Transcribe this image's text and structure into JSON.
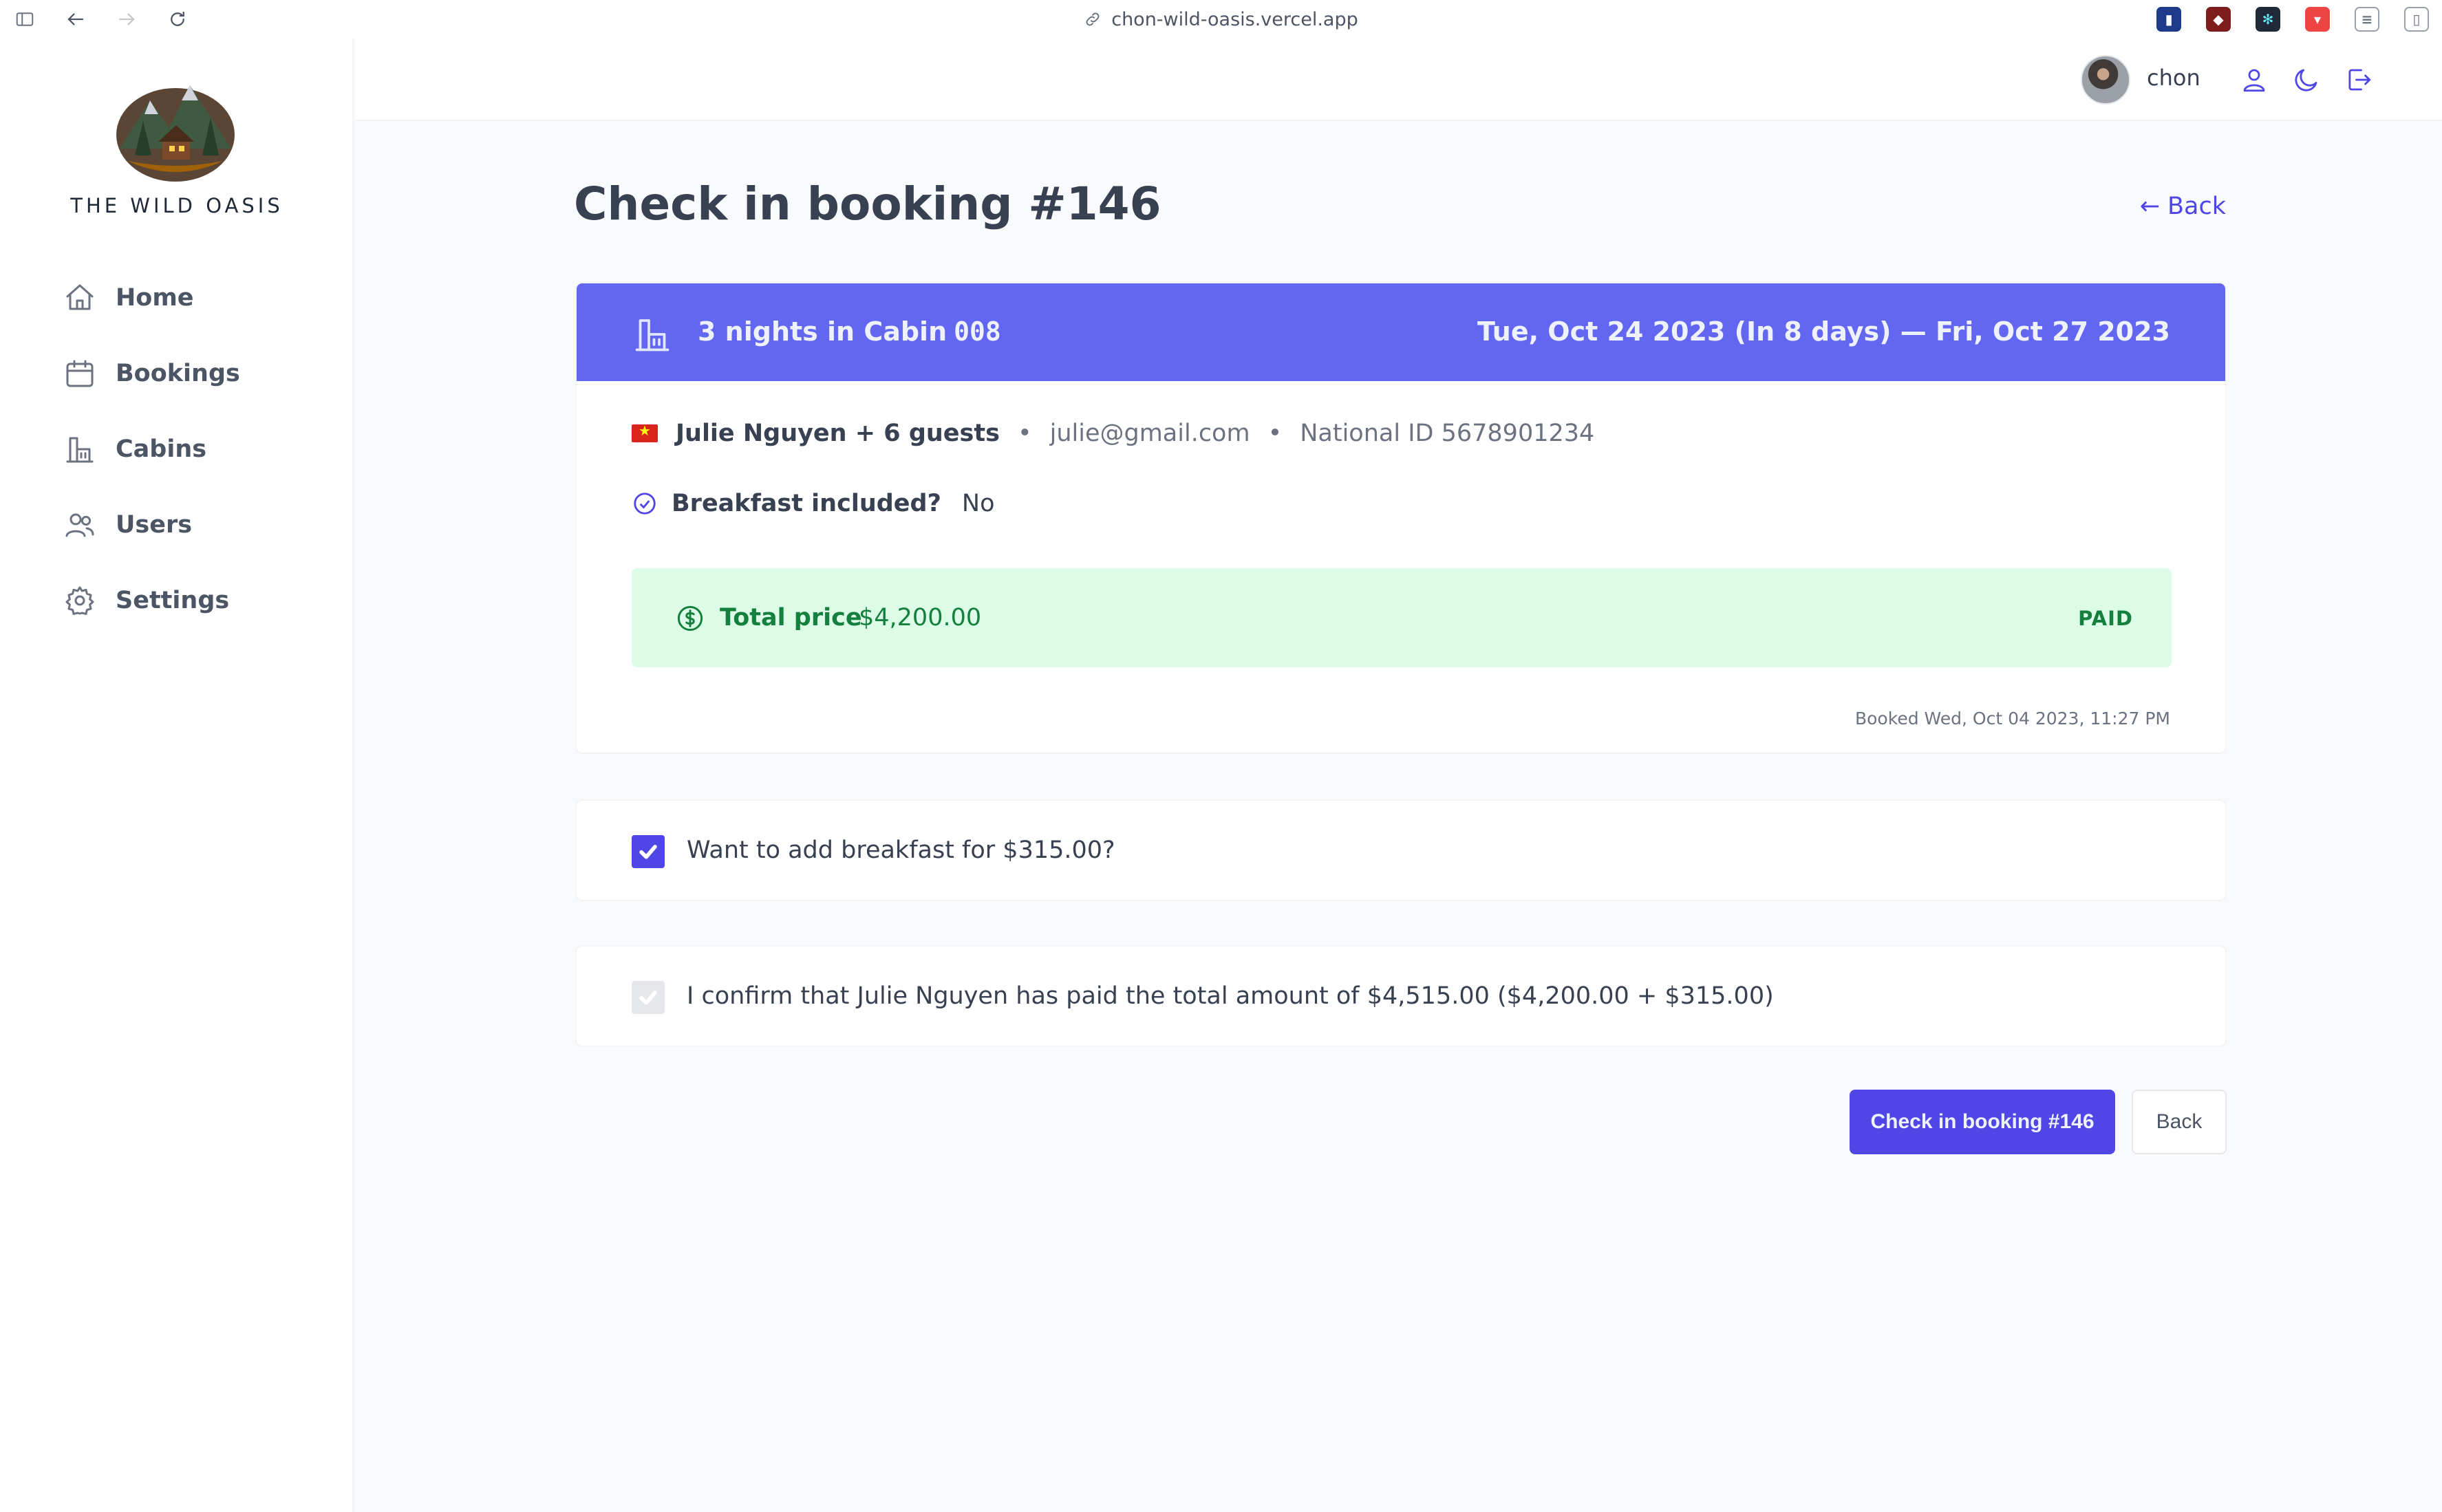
{
  "browser": {
    "url": "chon-wild-oasis.vercel.app"
  },
  "sidebar": {
    "brand": "THE WILD OASIS",
    "items": [
      {
        "label": "Home",
        "icon": "home-icon"
      },
      {
        "label": "Bookings",
        "icon": "calendar-icon"
      },
      {
        "label": "Cabins",
        "icon": "cabin-icon"
      },
      {
        "label": "Users",
        "icon": "users-icon"
      },
      {
        "label": "Settings",
        "icon": "gear-icon"
      }
    ]
  },
  "header": {
    "username": "chon"
  },
  "page": {
    "title": "Check in booking #146",
    "back_link": "← Back"
  },
  "booking": {
    "nights_text": "3 nights in Cabin",
    "cabin_code": "008",
    "dates": "Tue, Oct 24 2023 (In 8 days) — Fri, Oct 27 2023",
    "guest_name": "Julie Nguyen + 6 guests",
    "email": "julie@gmail.com",
    "national_id": "National ID 5678901234",
    "breakfast_label": "Breakfast included?",
    "breakfast_value": "No",
    "price_label": "Total price",
    "price_value": "$4,200.00",
    "paid_status": "PAID",
    "booked_at": "Booked Wed, Oct 04 2023, 11:27 PM"
  },
  "checks": {
    "add_breakfast": {
      "label": "Want to add breakfast for $315.00?",
      "checked": true
    },
    "confirm_paid": {
      "label": "I confirm that Julie Nguyen has paid the total amount of $4,515.00 ($4,200.00 + $315.00)",
      "checked": true,
      "disabled": true
    }
  },
  "actions": {
    "checkin_label": "Check in booking #146",
    "back_label": "Back"
  },
  "colors": {
    "accent": "#4f46e5",
    "banner": "#6366f1",
    "paid_bg": "#dcfce7",
    "paid_text": "#15803d"
  }
}
